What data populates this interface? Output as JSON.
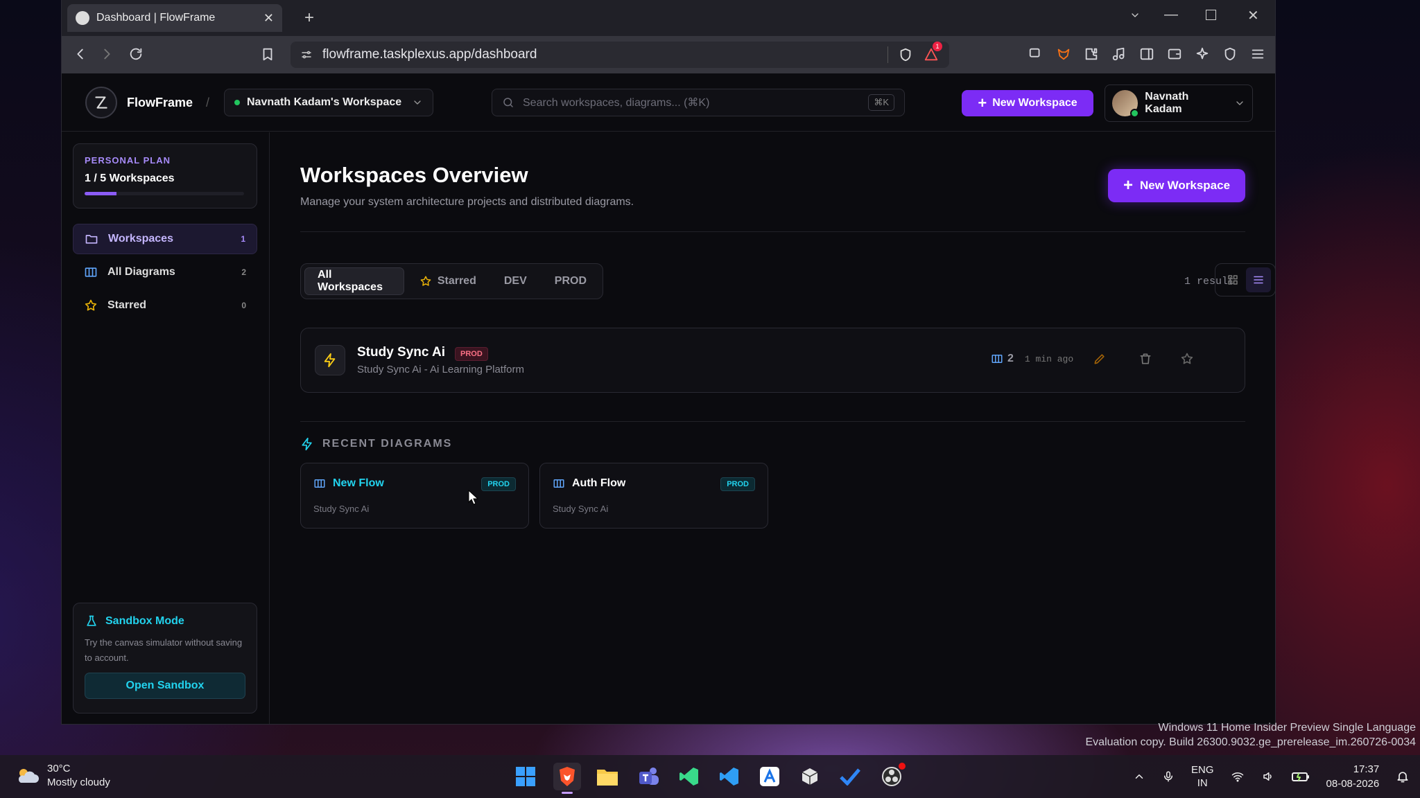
{
  "browser": {
    "tab_title": "Dashboard | FlowFrame",
    "url": "flowframe.taskplexus.app/dashboard",
    "notification_count": "1"
  },
  "header": {
    "brand": "FlowFrame",
    "separator": "/",
    "workspace_switcher": "Navnath Kadam's Workspace",
    "search_placeholder": "Search workspaces, diagrams... (⌘K)",
    "search_shortcut": "⌘K",
    "new_workspace_label": "New Workspace",
    "user_name": "Navnath Kadam"
  },
  "sidebar": {
    "plan_title": "PERSONAL PLAN",
    "plan_usage": "1 / 5 Workspaces",
    "plan_progress": 0.2,
    "items": [
      {
        "label": "Workspaces",
        "count": "1",
        "icon": "folder-icon"
      },
      {
        "label": "All Diagrams",
        "count": "2",
        "icon": "diagram-icon"
      },
      {
        "label": "Starred",
        "count": "0",
        "icon": "star-icon"
      }
    ],
    "sandbox": {
      "title": "Sandbox Mode",
      "description": "Try the canvas simulator without saving to account.",
      "button": "Open Sandbox"
    }
  },
  "main": {
    "title": "Workspaces Overview",
    "subtitle": "Manage your system architecture projects and distributed diagrams.",
    "new_workspace_label": "New Workspace",
    "filters": [
      "All Workspaces",
      "Starred",
      "DEV",
      "PROD"
    ],
    "active_filter": "All Workspaces",
    "result_count": "1 result",
    "workspace": {
      "name": "Study Sync Ai",
      "badge": "PROD",
      "description": "Study Sync Ai - Ai Learning Platform",
      "diagram_count": "2",
      "updated": "1 min ago"
    },
    "recent_heading": "RECENT DIAGRAMS",
    "recent": [
      {
        "name": "New Flow",
        "badge": "PROD",
        "workspace": "Study Sync Ai",
        "color": "#22d3ee"
      },
      {
        "name": "Auth Flow",
        "badge": "PROD",
        "workspace": "Study Sync Ai",
        "color": "#ffffff"
      }
    ]
  },
  "desktop": {
    "watermark_line1": "Windows 11 Home Insider Preview Single Language",
    "watermark_line2": "Evaluation copy. Build 26300.9032.ge_prerelease_im.260726-0034",
    "weather_temp": "30°C",
    "weather_desc": "Mostly cloudy",
    "lang_1": "ENG",
    "lang_2": "IN",
    "time": "17:37",
    "date": "08-08-2026"
  },
  "colors": {
    "accent": "#7c2cf5",
    "cyan": "#22d3ee",
    "prod_badge": "#fb7185"
  }
}
